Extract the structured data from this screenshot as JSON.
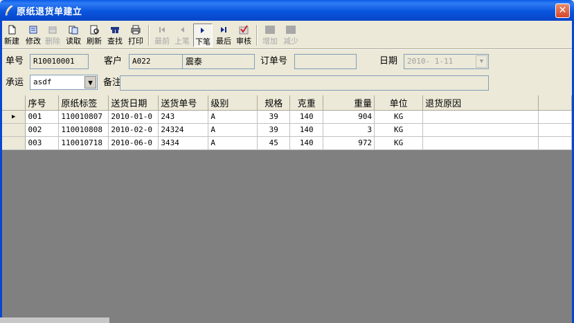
{
  "window": {
    "title": "原纸退货单建立",
    "close_glyph": "✕"
  },
  "toolbar": {
    "buttons": [
      {
        "label": "新建",
        "icon": "new-document-icon",
        "enabled": true
      },
      {
        "label": "修改",
        "icon": "edit-icon",
        "enabled": true
      },
      {
        "label": "删除",
        "icon": "delete-icon",
        "enabled": false
      },
      {
        "label": "读取",
        "icon": "read-icon",
        "enabled": true
      },
      {
        "label": "刷新",
        "icon": "refresh-icon",
        "enabled": true
      },
      {
        "label": "查找",
        "icon": "find-icon",
        "enabled": true
      },
      {
        "label": "打印",
        "icon": "print-icon",
        "enabled": true
      },
      {
        "label": "最前",
        "icon": "first-record-icon",
        "enabled": false
      },
      {
        "label": "上笔",
        "icon": "previous-record-icon",
        "enabled": false
      },
      {
        "label": "下笔",
        "icon": "next-record-icon",
        "enabled": true
      },
      {
        "label": "最后",
        "icon": "last-record-icon",
        "enabled": true
      },
      {
        "label": "审核",
        "icon": "approve-check-icon",
        "enabled": true
      },
      {
        "label": "增加",
        "icon": "add-row-icon",
        "enabled": false
      },
      {
        "label": "减少",
        "icon": "remove-row-icon",
        "enabled": false
      }
    ]
  },
  "form": {
    "order_no": {
      "label": "单号",
      "value": "R10010001"
    },
    "customer": {
      "label": "客户",
      "code": "A022",
      "name": "震泰"
    },
    "order_ref": {
      "label": "订单号",
      "value": ""
    },
    "date": {
      "label": "日期",
      "value": "2010- 1-11"
    },
    "carrier": {
      "label": "承运",
      "value": "asdf"
    },
    "remark": {
      "label": "备注",
      "value": ""
    }
  },
  "grid": {
    "columns": [
      "序号",
      "原纸标签",
      "送货日期",
      "送货单号",
      "级别",
      "规格",
      "克重",
      "重量",
      "单位",
      "退货原因"
    ],
    "current_row_marker": "▶",
    "rows": [
      [
        "001",
        "110010807",
        "2010-01-0",
        "243",
        "A",
        "39",
        "140",
        "904",
        "KG",
        ""
      ],
      [
        "002",
        "110010808",
        "2010-02-0",
        "24324",
        "A",
        "39",
        "140",
        "3",
        "KG",
        ""
      ],
      [
        "003",
        "110010718",
        "2010-06-0",
        "3434",
        "A",
        "45",
        "140",
        "972",
        "KG",
        ""
      ]
    ]
  },
  "colors": {
    "titlebar": "#0a55de",
    "face": "#ece9d8",
    "grid_empty": "#808080"
  }
}
